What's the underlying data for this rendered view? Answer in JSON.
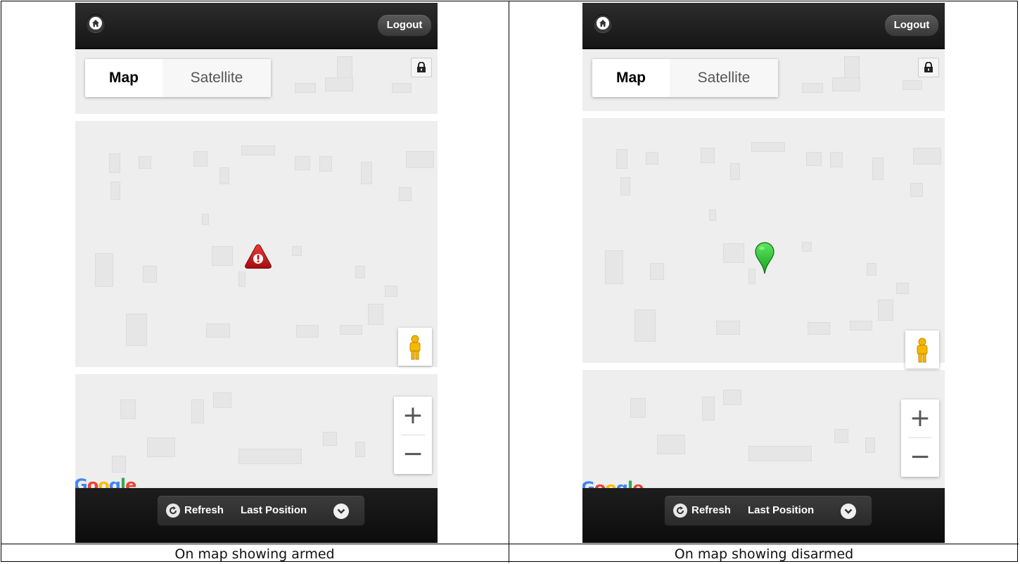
{
  "panels": [
    {
      "header": {
        "logout_label": "Logout"
      },
      "map_type": {
        "map_label": "Map",
        "satellite_label": "Satellite"
      },
      "marker": {
        "state": "armed",
        "icon": "warning-triangle-icon",
        "color": "#c8151b"
      },
      "bottom": {
        "refresh_label": "Refresh",
        "last_position_label": "Last Position"
      },
      "caption": "On map showing armed"
    },
    {
      "header": {
        "logout_label": "Logout"
      },
      "map_type": {
        "map_label": "Map",
        "satellite_label": "Satellite"
      },
      "marker": {
        "state": "disarmed",
        "icon": "map-pin-icon",
        "color": "#22c02a"
      },
      "bottom": {
        "refresh_label": "Refresh",
        "last_position_label": "Last Position"
      },
      "caption": "On map showing disarmed"
    }
  ],
  "google_logo": "Google"
}
